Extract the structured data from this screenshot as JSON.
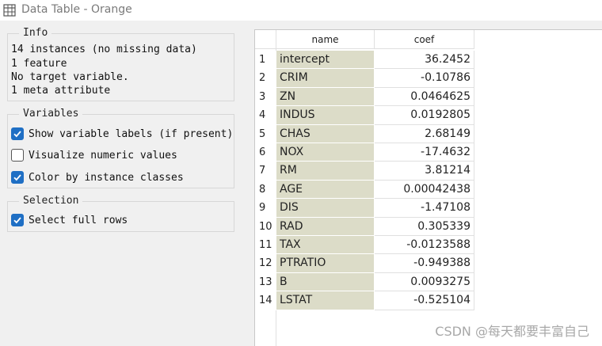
{
  "window": {
    "title": "Data Table - Orange"
  },
  "info": {
    "title": "Info",
    "lines": [
      "14 instances (no missing data)",
      "1 feature",
      "No target variable.",
      "1 meta attribute"
    ]
  },
  "variables": {
    "title": "Variables",
    "options": [
      {
        "label": "Show variable labels (if present)",
        "checked": true
      },
      {
        "label": "Visualize numeric values",
        "checked": false
      },
      {
        "label": "Color by instance classes",
        "checked": true
      }
    ]
  },
  "selection": {
    "title": "Selection",
    "options": [
      {
        "label": "Select full rows",
        "checked": true
      }
    ]
  },
  "table": {
    "columns": [
      "name",
      "coef"
    ],
    "rows": [
      {
        "num": "1",
        "name": "intercept",
        "coef": "36.2452"
      },
      {
        "num": "2",
        "name": "CRIM",
        "coef": "-0.10786"
      },
      {
        "num": "3",
        "name": "ZN",
        "coef": "0.0464625"
      },
      {
        "num": "4",
        "name": "INDUS",
        "coef": "0.0192805"
      },
      {
        "num": "5",
        "name": "CHAS",
        "coef": "2.68149"
      },
      {
        "num": "6",
        "name": "NOX",
        "coef": "-17.4632"
      },
      {
        "num": "7",
        "name": "RM",
        "coef": "3.81214"
      },
      {
        "num": "8",
        "name": "AGE",
        "coef": "0.00042438"
      },
      {
        "num": "9",
        "name": "DIS",
        "coef": "-1.47108"
      },
      {
        "num": "10",
        "name": "RAD",
        "coef": "0.305339"
      },
      {
        "num": "11",
        "name": "TAX",
        "coef": "-0.0123588"
      },
      {
        "num": "12",
        "name": "PTRATIO",
        "coef": "-0.949388"
      },
      {
        "num": "13",
        "name": "B",
        "coef": "0.0093275"
      },
      {
        "num": "14",
        "name": "LSTAT",
        "coef": "-0.525104"
      }
    ]
  },
  "watermark": "CSDN @每天都要丰富自己",
  "colors": {
    "meta_cell": "#dcdcc8",
    "checkbox": "#1f6fc4"
  },
  "icons": {
    "app": "table-grid-icon",
    "check": "checkmark-icon"
  }
}
